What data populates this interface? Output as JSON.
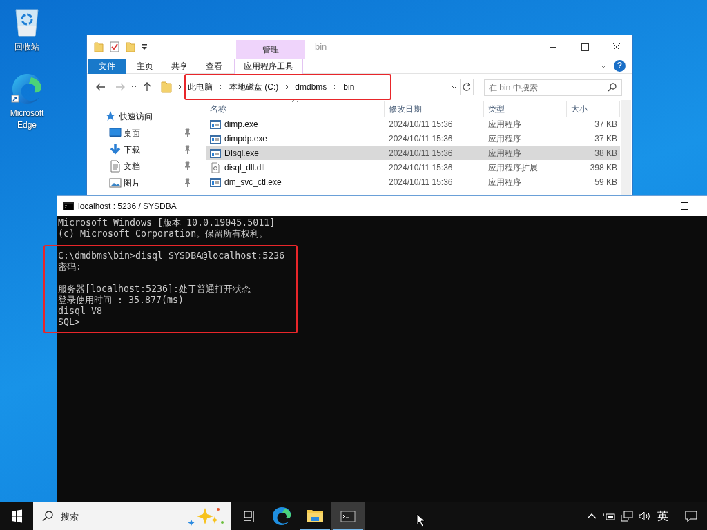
{
  "desktop_icons": [
    {
      "kind": "recycle-bin",
      "label": "回收站"
    },
    {
      "kind": "edge",
      "label": "Microsoft Edge"
    }
  ],
  "explorer": {
    "title": "bin",
    "context_tab": "管理",
    "ribbon_tabs": [
      {
        "kind": "file",
        "label": "文件",
        "selected": false
      },
      {
        "kind": "tab",
        "label": "主页",
        "selected": false
      },
      {
        "kind": "tab",
        "label": "共享",
        "selected": false
      },
      {
        "kind": "tab",
        "label": "查看",
        "selected": false
      },
      {
        "kind": "context",
        "label": "应用程序工具",
        "selected": true
      }
    ],
    "address_path": [
      "此电脑",
      "本地磁盘 (C:)",
      "dmdbms",
      "bin"
    ],
    "search": {
      "placeholder": "在 bin 中搜索"
    },
    "help_label": "?",
    "nav_items": [
      {
        "kind": "quick-access",
        "label": "快速访问",
        "pinned": false
      },
      {
        "kind": "desktop",
        "label": "桌面",
        "pinned": true
      },
      {
        "kind": "downloads",
        "label": "下载",
        "pinned": true
      },
      {
        "kind": "documents",
        "label": "文档",
        "pinned": true
      },
      {
        "kind": "pictures",
        "label": "图片",
        "pinned": true
      }
    ],
    "columns": [
      "名称",
      "修改日期",
      "类型",
      "大小"
    ],
    "files": [
      {
        "kind": "exe",
        "name": "dimp.exe",
        "date": "2024/10/11 15:36",
        "type": "应用程序",
        "size": "37 KB",
        "selected": false
      },
      {
        "kind": "exe",
        "name": "dimpdp.exe",
        "date": "2024/10/11 15:36",
        "type": "应用程序",
        "size": "37 KB",
        "selected": false
      },
      {
        "kind": "exe",
        "name": "DIsql.exe",
        "date": "2024/10/11 15:36",
        "type": "应用程序",
        "size": "38 KB",
        "selected": true
      },
      {
        "kind": "dll",
        "name": "disql_dll.dll",
        "date": "2024/10/11 15:36",
        "type": "应用程序扩展",
        "size": "398 KB",
        "selected": false
      },
      {
        "kind": "exe",
        "name": "dm_svc_ctl.exe",
        "date": "2024/10/11 15:36",
        "type": "应用程序",
        "size": "59 KB",
        "selected": false
      }
    ]
  },
  "console": {
    "title": "localhost : 5236 / SYSDBA",
    "blocks": [
      {
        "lines": [
          "Microsoft Windows [版本 10.0.19045.5011]",
          "(c) Microsoft Corporation。保留所有权利。"
        ]
      },
      {
        "lines": [
          "C:\\dmdbms\\bin>disql SYSDBA@localhost:5236",
          "密码:"
        ]
      },
      {
        "lines": [
          "服务器[localhost:5236]:处于普通打开状态",
          "登录使用时间 : 35.877(ms)",
          "disql V8",
          "SQL>"
        ]
      }
    ]
  },
  "taskbar": {
    "search_placeholder": "搜索",
    "apps": [
      {
        "kind": "task-view",
        "running": false,
        "selected": false
      },
      {
        "kind": "edge",
        "running": false,
        "selected": false
      },
      {
        "kind": "explorer",
        "running": true,
        "selected": false
      },
      {
        "kind": "terminal",
        "running": true,
        "selected": true
      }
    ],
    "input_method": "英"
  }
}
